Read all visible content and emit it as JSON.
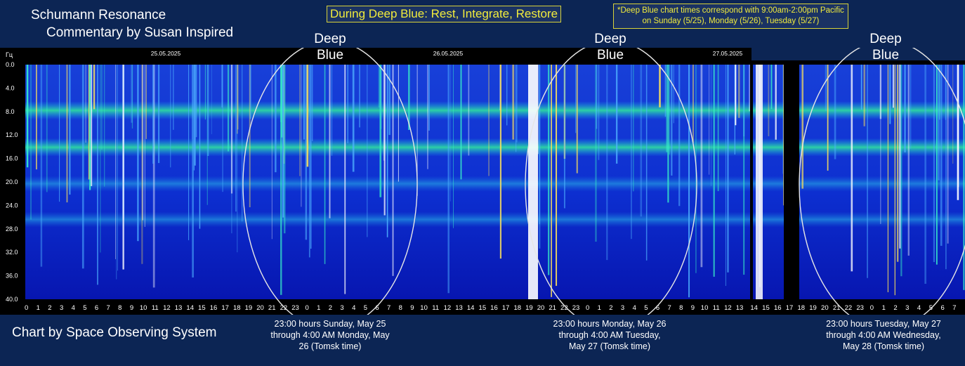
{
  "page": {
    "title_line1": "Schumann Resonance",
    "title_line2": "Commentary by Susan Inspired",
    "theme_banner": "During Deep Blue: Rest, Integrate, Restore",
    "note_line1": "*Deep Blue chart times correspond with 9:00am-2:00pm Pacific",
    "note_line2": "on Sunday (5/25), Monday (5/26), Tuesday (5/27)",
    "credit": "Chart by Space Observing System",
    "deep_blue_labels": [
      {
        "line1": "Deep",
        "line2": "Blue"
      },
      {
        "line1": "Deep",
        "line2": "Blue"
      },
      {
        "line1": "Deep",
        "line2": "Blue"
      }
    ],
    "captions": [
      {
        "line1": "23:00 hours Sunday, May 25",
        "line2": "through 4:00 AM Monday, May",
        "line3": "26 (Tomsk time)"
      },
      {
        "line1": "23:00 hours Monday, May 26",
        "line2": "through 4:00 AM Tuesday,",
        "line3": "May 27 (Tomsk time)"
      },
      {
        "line1": "23:00 hours Tuesday, May 27",
        "line2": "through 4:00 AM Wednesday,",
        "line3": "May 28 (Tomsk time)"
      }
    ],
    "colors": {
      "background": "#0c2554",
      "highlight": "#f2ec3c",
      "spectrogram_base": "#0a1fb8",
      "ellipse": "#e6e6e6"
    }
  },
  "chart_data": {
    "type": "heatmap",
    "y_unit_label": "Гц",
    "y_ticks": [
      "0.0",
      "4.0",
      "8.0",
      "12.0",
      "16.0",
      "20.0",
      "24.0",
      "28.0",
      "32.0",
      "36.0",
      "40.0"
    ],
    "ylim": [
      0,
      40
    ],
    "date_labels": [
      "25.05.2025",
      "26.05.2025",
      "27.05.2025"
    ],
    "hour_ticks_panel1": [
      "0",
      "1",
      "2",
      "3",
      "4",
      "5",
      "6",
      "7",
      "8",
      "9",
      "10",
      "11",
      "12",
      "13",
      "14",
      "15",
      "16",
      "17",
      "18",
      "19",
      "20",
      "21",
      "22",
      "23",
      "0",
      "1",
      "2",
      "3",
      "4",
      "5",
      "6",
      "7",
      "8",
      "9",
      "10",
      "11",
      "12",
      "13",
      "14",
      "15",
      "16",
      "17",
      "18",
      "19",
      "20",
      "21",
      "22",
      "23",
      "0",
      "1",
      "2",
      "3",
      "4",
      "5",
      "6",
      "7",
      "8",
      "9",
      "10",
      "11",
      "12",
      "13"
    ],
    "hour_ticks_panel2": [
      "14",
      "15",
      "16",
      "17",
      "18",
      "19",
      "20",
      "21",
      "22",
      "23",
      "0",
      "1",
      "2",
      "3",
      "4",
      "5",
      "6",
      "7"
    ],
    "resonance_bands_hz": [
      7.8,
      14.1,
      20.3,
      26.4
    ],
    "deep_blue_windows": [
      {
        "start": "2025-05-25 23:00",
        "end": "2025-05-26 04:00"
      },
      {
        "start": "2025-05-26 23:00",
        "end": "2025-05-27 04:00"
      },
      {
        "start": "2025-05-27 23:00",
        "end": "2025-05-28 04:00"
      }
    ],
    "grid": false
  }
}
